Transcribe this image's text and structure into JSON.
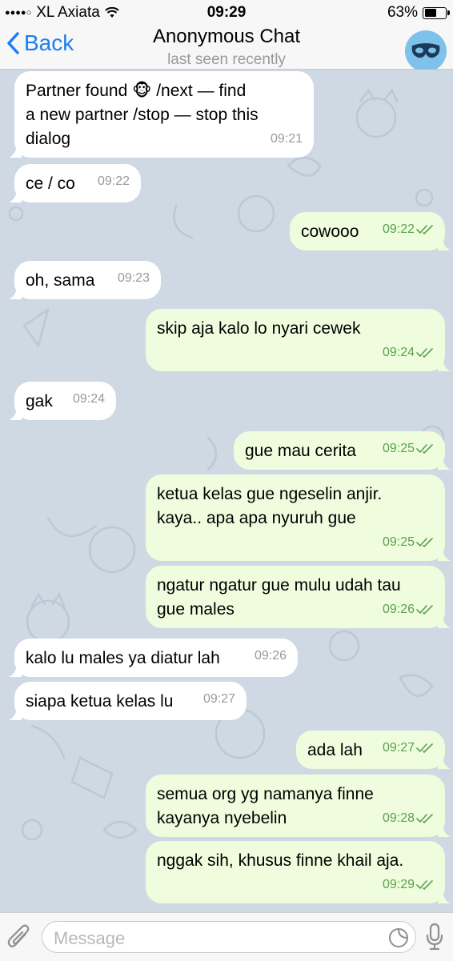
{
  "status": {
    "carrier": "XL Axiata",
    "time": "09:29",
    "battery": "63%",
    "battery_level": 0.63
  },
  "header": {
    "back_label": "Back",
    "title": "Anonymous Chat",
    "subtitle": "last seen recently",
    "avatar_icon": "mask-icon"
  },
  "messages": [
    {
      "dir": "in",
      "lines": [
        "Partner found 🐵 /next — find",
        "a new partner /stop — stop this",
        "dialog"
      ],
      "time": "09:21"
    },
    {
      "dir": "in",
      "lines": [
        "ce / co"
      ],
      "time": "09:22"
    },
    {
      "dir": "out",
      "lines": [
        "cowooo"
      ],
      "time": "09:22"
    },
    {
      "dir": "in",
      "lines": [
        "oh, sama"
      ],
      "time": "09:23"
    },
    {
      "dir": "out",
      "lines": [
        "skip aja kalo lo nyari cewek"
      ],
      "time": "09:24"
    },
    {
      "dir": "in",
      "lines": [
        "gak"
      ],
      "time": "09:24"
    },
    {
      "dir": "out",
      "lines": [
        "gue mau cerita"
      ],
      "time": "09:25"
    },
    {
      "dir": "out",
      "lines": [
        "ketua kelas gue ngeselin anjir.",
        "kaya.. apa apa nyuruh gue"
      ],
      "time": "09:25"
    },
    {
      "dir": "out",
      "lines": [
        "ngatur ngatur gue mulu udah tau",
        "gue males"
      ],
      "time": "09:26"
    },
    {
      "dir": "in",
      "lines": [
        "kalo lu males ya diatur lah"
      ],
      "time": "09:26"
    },
    {
      "dir": "in",
      "lines": [
        "siapa ketua kelas lu"
      ],
      "time": "09:27"
    },
    {
      "dir": "out",
      "lines": [
        "ada lah"
      ],
      "time": "09:27"
    },
    {
      "dir": "out",
      "lines": [
        "semua org yg namanya finne",
        "kayanya nyebelin"
      ],
      "time": "09:28"
    },
    {
      "dir": "out",
      "lines": [
        "nggak sih, khusus finne khail aja."
      ],
      "time": "09:29"
    }
  ],
  "input": {
    "placeholder": "Message"
  },
  "colors": {
    "accent": "#1a7ef5",
    "outgoing_bubble": "#effdde",
    "incoming_bubble": "#ffffff",
    "outgoing_time": "#5aa14c",
    "background": "#cfd9e3"
  }
}
